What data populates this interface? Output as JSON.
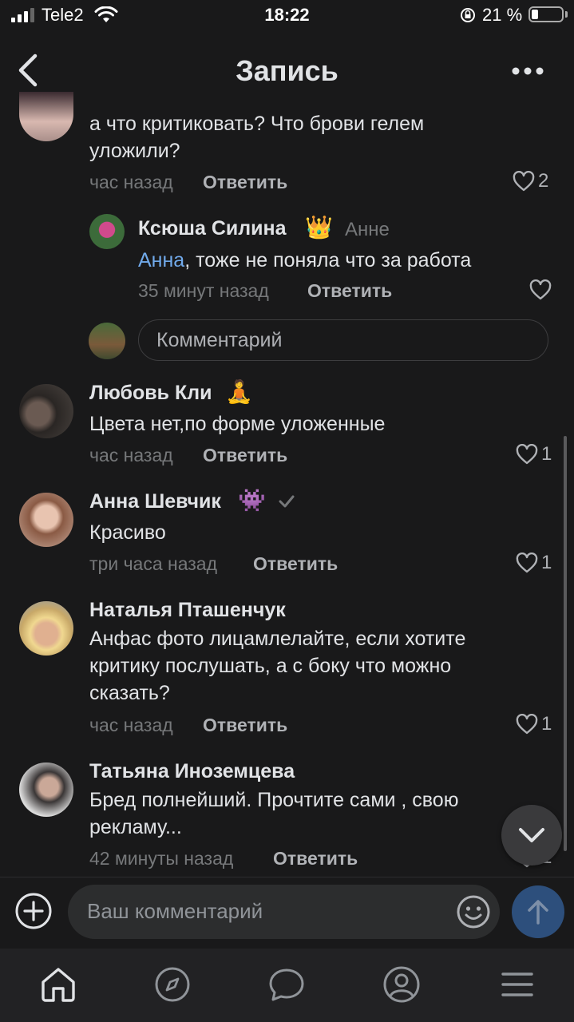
{
  "status_bar": {
    "carrier": "Tele2",
    "time": "18:22",
    "battery_percent": "21 %",
    "battery_level": 0.21
  },
  "header": {
    "title": "Запись"
  },
  "comments": [
    {
      "text": "а что критиковать? Что брови гелем уложили?",
      "time": "час назад",
      "reply": "Ответить",
      "likes": "2"
    },
    {
      "name": "Ксюша Силина",
      "emoji": "👑",
      "reply_to": "Анне",
      "mention": "Анна",
      "text": ", тоже не поняла что за работа",
      "time": "35 минут назад",
      "reply": "Ответить"
    },
    {
      "name": "Любовь Кли",
      "emoji": "🧘",
      "text": "Цвета нет,по форме уложенные",
      "time": "час назад",
      "reply": "Ответить",
      "likes": "1"
    },
    {
      "name": "Анна Шевчик",
      "emoji": "👾",
      "text": "Красиво",
      "time": "три часа назад",
      "reply": "Ответить",
      "likes": "1"
    },
    {
      "name": "Наталья Пташенчук",
      "text": "Анфас фото лицамлелайте, если хотите критику послушать, а с боку что можно сказать?",
      "time": "час назад",
      "reply": "Ответить",
      "likes": "1"
    },
    {
      "name": "Татьяна Иноземцева",
      "text": "Бред полнейший. Прочтите сами , свою рекламу...",
      "time": "42 минуты назад",
      "reply": "Ответить",
      "likes": "1"
    }
  ],
  "thread_reply": {
    "placeholder": "Комментарий"
  },
  "composer": {
    "placeholder": "Ваш комментарий"
  },
  "icons": [
    "chevron-left-icon",
    "more-icon",
    "heart-icon",
    "chevron-down-icon",
    "plus-icon",
    "smile-icon",
    "arrow-up-icon",
    "home-icon",
    "compass-icon",
    "chat-icon",
    "profile-icon",
    "menu-icon"
  ],
  "colors": {
    "background": "#19191a",
    "text": "#e1e3e6",
    "secondary": "#76787a",
    "mention": "#71aaeb",
    "send_button": "#2d4f7c"
  }
}
